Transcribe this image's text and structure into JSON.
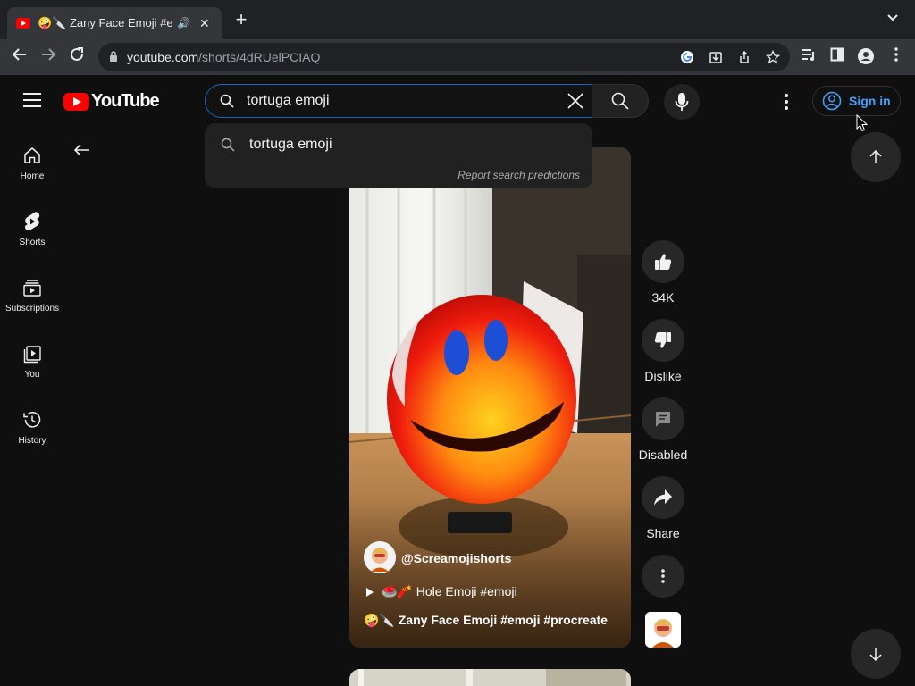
{
  "browser": {
    "tab_title": "🤪🔪 Zany Face Emoji #emoji #procreate",
    "tab_close": "✕",
    "new_tab": "+",
    "tab_list": "⌄",
    "url_host": "youtube.com",
    "url_path": "/shorts/4dRUelPCIAQ",
    "icons": [
      "back-icon",
      "forward-icon",
      "reload-icon",
      "lock-icon",
      "google-icon",
      "install-icon",
      "share-icon",
      "star-icon",
      "reading-list-icon",
      "side-panel-icon",
      "profile-icon",
      "menu-icon"
    ]
  },
  "header": {
    "logo_text": "YouTube",
    "search": {
      "value": "tortuga emoji",
      "placeholder": "Search"
    },
    "signin_label": "Sign in"
  },
  "suggestions": {
    "items": [
      "tortuga emoji"
    ],
    "report_label": "Report search predictions"
  },
  "sidebar": {
    "items": [
      {
        "label": "Home",
        "icon": "home-icon"
      },
      {
        "label": "Shorts",
        "icon": "shorts-icon"
      },
      {
        "label": "Subscriptions",
        "icon": "subscriptions-icon"
      },
      {
        "label": "You",
        "icon": "you-icon"
      },
      {
        "label": "History",
        "icon": "history-icon"
      }
    ]
  },
  "short": {
    "channel": "@Screamojishorts",
    "related": "🥌🧨 Hole Emoji #emoji",
    "title": "🤪🔪 Zany Face Emoji #emoji #procreate"
  },
  "actions": {
    "like": "34K",
    "dislike": "Dislike",
    "comments": "Disabled",
    "share": "Share"
  },
  "colors": {
    "background": "#0f0f0f",
    "brand_red": "#ff0000",
    "link_blue": "#3ea6ff",
    "search_focus": "#1c62b9"
  }
}
